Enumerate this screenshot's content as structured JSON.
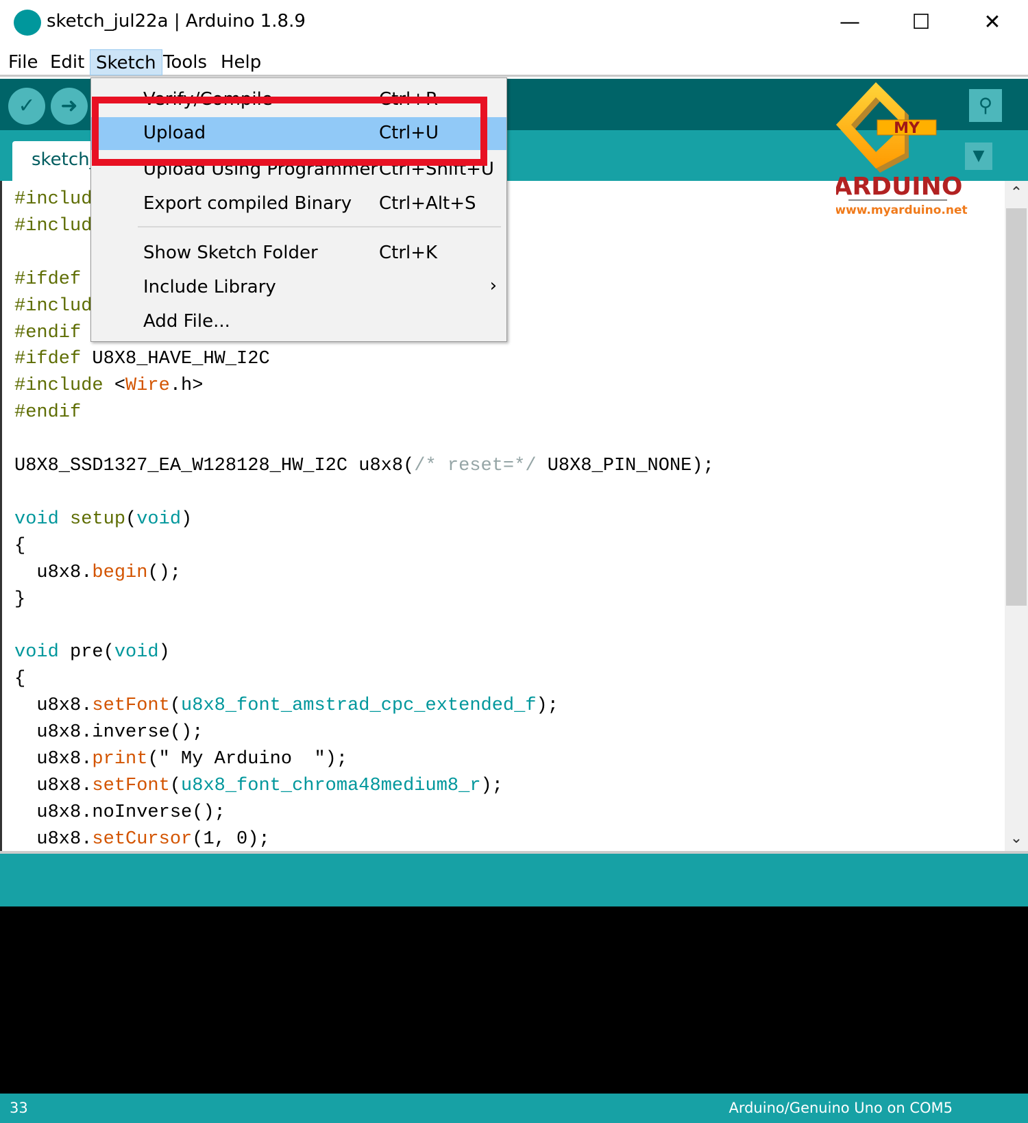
{
  "window": {
    "title": "sketch_jul22a | Arduino 1.8.9",
    "minimize": "—",
    "maximize": "☐",
    "close": "✕"
  },
  "menubar": [
    "File",
    "Edit",
    "Sketch",
    "Tools",
    "Help"
  ],
  "toolbar": {
    "verify_icon": "✓",
    "upload_icon": "➜",
    "serial_icon": "⚲"
  },
  "tab": {
    "label": "sketch_",
    "menu_icon": "▼"
  },
  "sketch_menu": {
    "items": [
      {
        "label": "Verify/Compile",
        "shortcut": "Ctrl+R"
      },
      {
        "label": "Upload",
        "shortcut": "Ctrl+U",
        "highlighted": true
      },
      {
        "label": "Upload Using Programmer",
        "shortcut": "Ctrl+Shift+U"
      },
      {
        "label": "Export compiled Binary",
        "shortcut": "Ctrl+Alt+S"
      },
      {
        "label": "Show Sketch Folder",
        "shortcut": "Ctrl+K"
      },
      {
        "label": "Include Library",
        "shortcut": "",
        "submenu": "›"
      },
      {
        "label": "Add File...",
        "shortcut": ""
      }
    ],
    "annotation_color": "#e81123"
  },
  "logo": {
    "badge": "MY",
    "name": "ARDUINO",
    "url": "www.myarduino.net"
  },
  "code": [
    [
      [
        "#includ",
        "pp"
      ]
    ],
    [
      [
        "#includ",
        "pp"
      ]
    ],
    [],
    [
      [
        "#ifdef",
        "pp"
      ]
    ],
    [
      [
        "#includ",
        "pp"
      ]
    ],
    [
      [
        "#endif",
        "pp"
      ]
    ],
    [
      [
        "#ifdef",
        "pp"
      ],
      [
        " U8X8_HAVE_HW_I2C",
        ""
      ]
    ],
    [
      [
        "#include",
        "pp"
      ],
      [
        " <",
        ""
      ],
      [
        "Wire",
        "fn"
      ],
      [
        ".h>",
        ""
      ]
    ],
    [
      [
        "#endif",
        "pp"
      ]
    ],
    [],
    [
      [
        "U8X8_SSD1327_EA_W128128_HW_I2C u8x8(",
        ""
      ],
      [
        "/* reset=*/",
        "cm"
      ],
      [
        " U8X8_PIN_NONE);",
        ""
      ]
    ],
    [],
    [
      [
        "void",
        "kw"
      ],
      [
        " ",
        ""
      ],
      [
        "setup",
        "pp"
      ],
      [
        "(",
        ""
      ],
      [
        "void",
        "kw"
      ],
      [
        ")",
        ""
      ]
    ],
    [
      [
        "{",
        ""
      ]
    ],
    [
      [
        "  u8x8.",
        ""
      ],
      [
        "begin",
        "fn"
      ],
      [
        "();",
        ""
      ]
    ],
    [
      [
        "}",
        ""
      ]
    ],
    [],
    [
      [
        "void",
        "kw"
      ],
      [
        " pre(",
        ""
      ],
      [
        "void",
        "kw"
      ],
      [
        ")",
        ""
      ]
    ],
    [
      [
        "{",
        ""
      ]
    ],
    [
      [
        "  u8x8.",
        ""
      ],
      [
        "setFont",
        "fn"
      ],
      [
        "(",
        ""
      ],
      [
        "u8x8_font_amstrad_cpc_extended_f",
        "ct"
      ],
      [
        ");",
        ""
      ]
    ],
    [
      [
        "  u8x8.inverse();",
        ""
      ]
    ],
    [
      [
        "  u8x8.",
        ""
      ],
      [
        "print",
        "fn"
      ],
      [
        "(\" My Arduino  \");",
        ""
      ]
    ],
    [
      [
        "  u8x8.",
        ""
      ],
      [
        "setFont",
        "fn"
      ],
      [
        "(",
        ""
      ],
      [
        "u8x8_font_chroma48medium8_r",
        "ct"
      ],
      [
        ");",
        ""
      ]
    ],
    [
      [
        "  u8x8.noInverse();",
        ""
      ]
    ],
    [
      [
        "  u8x8.",
        ""
      ],
      [
        "setCursor",
        "fn"
      ],
      [
        "(1, 0);",
        ""
      ]
    ]
  ],
  "scrollbar": {
    "up": "⌃",
    "down": "⌄"
  },
  "footer": {
    "line": "33",
    "board": "Arduino/Genuino Uno on COM5"
  },
  "colors": {
    "toolbar": "#006468",
    "tabbar": "#17A1A5",
    "highlight": "#91c9f7"
  }
}
